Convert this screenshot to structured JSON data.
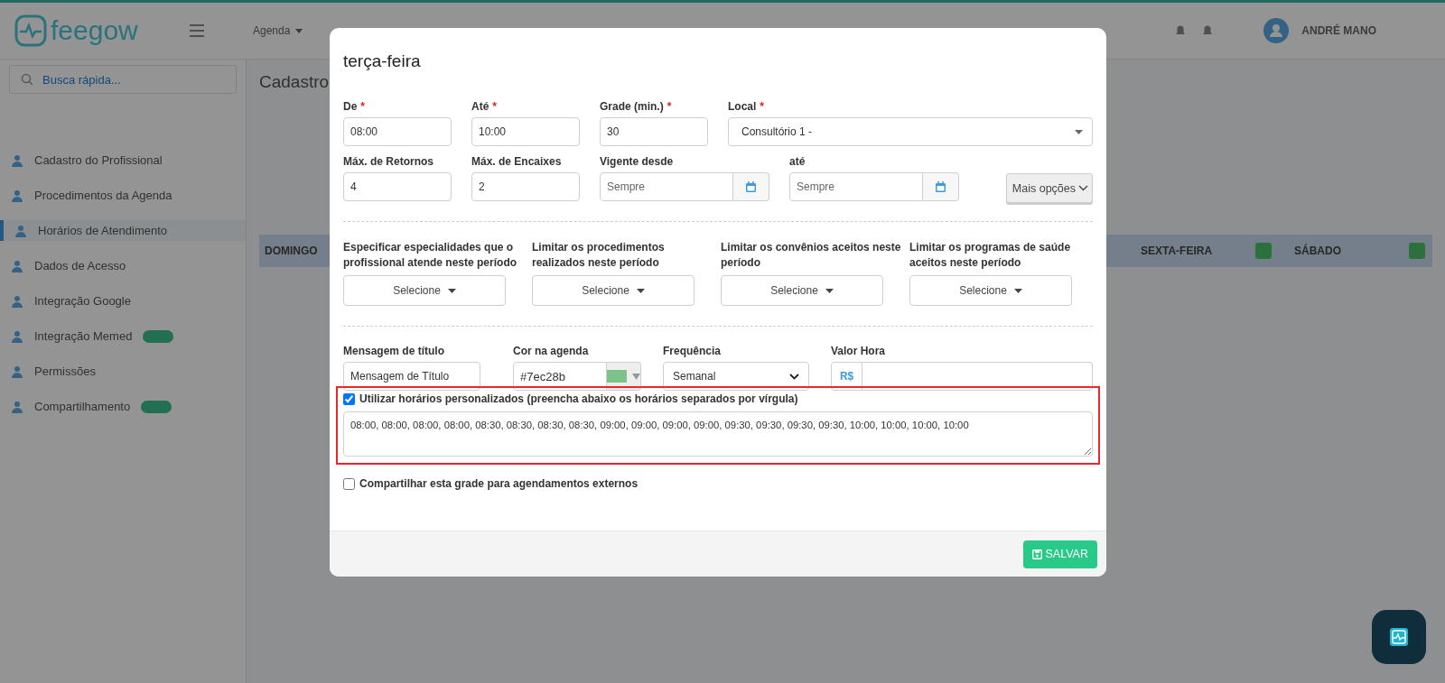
{
  "header": {
    "logo": "feegow",
    "nav": [
      {
        "label": "Agenda"
      }
    ],
    "user": "ANDRÉ MANO"
  },
  "sidebar": {
    "search": {
      "placeholder": "Busca rápida..."
    },
    "items": [
      {
        "label": "Cadastro do Profissional",
        "selected": false,
        "new": false
      },
      {
        "label": "Procedimentos da Agenda",
        "selected": false,
        "new": false
      },
      {
        "label": "Horários de Atendimento",
        "selected": true,
        "new": false
      },
      {
        "label": "Dados de Acesso",
        "selected": false,
        "new": false
      },
      {
        "label": "Integração Google",
        "selected": false,
        "new": false
      },
      {
        "label": "Integração Memed",
        "selected": false,
        "new": true
      },
      {
        "label": "Permissões",
        "selected": false,
        "new": false
      },
      {
        "label": "Compartilhamento",
        "selected": false,
        "new": true
      }
    ]
  },
  "content": {
    "title": "Cadastro",
    "days": [
      "DOMINGO",
      "SEXTA-FEIRA",
      "SÁBADO"
    ]
  },
  "modal": {
    "title": "terça-feira",
    "required_mark": "*",
    "row1": [
      {
        "label": "De",
        "required": true,
        "value": "08:00"
      },
      {
        "label": "Até",
        "required": true,
        "value": "10:00"
      },
      {
        "label": "Grade (min.)",
        "required": true,
        "value": "30"
      }
    ],
    "local": {
      "label": "Local",
      "required": true,
      "value": "Consultório 1 -"
    },
    "row2": [
      {
        "label": "Máx. de Retornos",
        "value": "4"
      },
      {
        "label": "Máx. de Encaixes",
        "value": "2"
      }
    ],
    "dates": [
      {
        "label": "Vigente desde",
        "placeholder": "Sempre"
      },
      {
        "label": "até",
        "placeholder": "Sempre"
      }
    ],
    "more_button": "Mais opções",
    "limits": [
      {
        "label": "Especificar especialidades que o profissional atende neste período",
        "value": "Selecione"
      },
      {
        "label": "Limitar os procedimentos realizados neste período",
        "value": "Selecione"
      },
      {
        "label": "Limitar os convênios aceitos neste período",
        "value": "Selecione"
      },
      {
        "label": "Limitar os programas de saúde aceitos neste período",
        "value": "Selecione"
      }
    ],
    "message": {
      "label": "Mensagem de título",
      "value": "Mensagem de Título"
    },
    "color": {
      "label": "Cor na agenda",
      "value": "#7ec28b",
      "color": "#7ec28b"
    },
    "frequency": {
      "label": "Frequência",
      "value": "Semanal"
    },
    "hour_value": {
      "label": "Valor Hora",
      "prefix": "R$"
    },
    "custom": {
      "checked": true,
      "label": "Utilizar horários personalizados (preencha abaixo os horários separados por vírgula)",
      "value": "08:00, 08:00, 08:00, 08:00, 08:30, 08:30, 08:30, 08:30, 09:00, 09:00, 09:00, 09:00, 09:30, 09:30, 09:30, 09:30, 10:00, 10:00, 10:00, 10:00"
    },
    "share": {
      "checked": false,
      "label": "Compartilhar esta grade para agendamentos externos"
    },
    "save_button": "SALVAR"
  }
}
